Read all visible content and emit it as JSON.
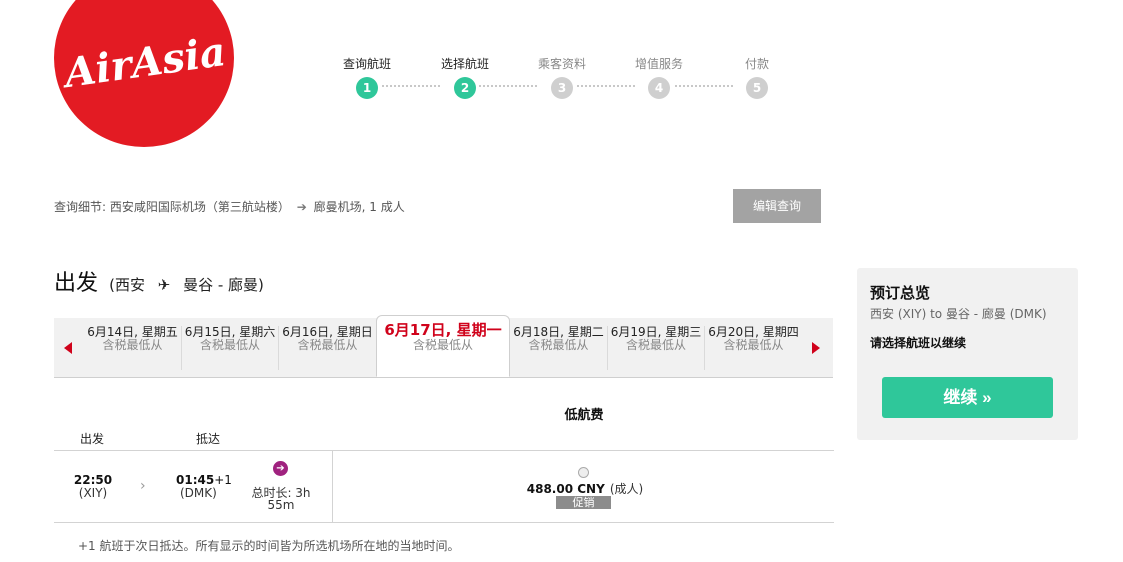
{
  "brand": {
    "logo_text": "AirAsia",
    "color": "#e31b23"
  },
  "stepper": {
    "steps": [
      {
        "label": "查询航班",
        "number": "1"
      },
      {
        "label": "选择航班",
        "number": "2"
      },
      {
        "label": "乘客资料",
        "number": "3"
      },
      {
        "label": "增值服务",
        "number": "4"
      },
      {
        "label": "付款",
        "number": "5"
      }
    ],
    "active_color": "#2fc79a",
    "inactive_color": "#cfcfcf"
  },
  "search": {
    "prefix": "查询细节:",
    "origin": "西安咸阳国际机场（第三航站楼）",
    "destination": "廊曼机场, 1 成人",
    "edit_label": "编辑查询"
  },
  "departure": {
    "title": "出发",
    "route_open": "(西安",
    "route_close": "曼谷 - 廊曼)"
  },
  "dates": [
    {
      "date": "6月14日, 星期五",
      "sub": "含税最低从"
    },
    {
      "date": "6月15日, 星期六",
      "sub": "含税最低从"
    },
    {
      "date": "6月16日, 星期日",
      "sub": "含税最低从"
    },
    {
      "date": "6月17日, 星期一",
      "sub": "含税最低从"
    },
    {
      "date": "6月18日, 星期二",
      "sub": "含税最低从"
    },
    {
      "date": "6月19日, 星期三",
      "sub": "含税最低从"
    },
    {
      "date": "6月20日, 星期四",
      "sub": "含税最低从"
    }
  ],
  "table": {
    "fare_header": "低航费",
    "col_depart": "出发",
    "col_arrive": "抵达"
  },
  "flight": {
    "depart_time": "22:50",
    "depart_code": "(XIY)",
    "arrive_time": "01:45",
    "arrive_plus": "+1",
    "arrive_code": "(DMK)",
    "duration_line1": "总时长: 3h",
    "duration_line2": "55m",
    "price": "488.00 CNY",
    "price_pax": "(成人)",
    "promo": "促销"
  },
  "footnote": "+1 航班于次日抵达。所有显示的时间皆为所选机场所在地的当地时间。",
  "summary": {
    "title": "预订总览",
    "route": "西安 (XIY) to 曼谷 - 廊曼 (DMK)",
    "note": "请选择航班以继续",
    "continue_label": "继续 »"
  }
}
